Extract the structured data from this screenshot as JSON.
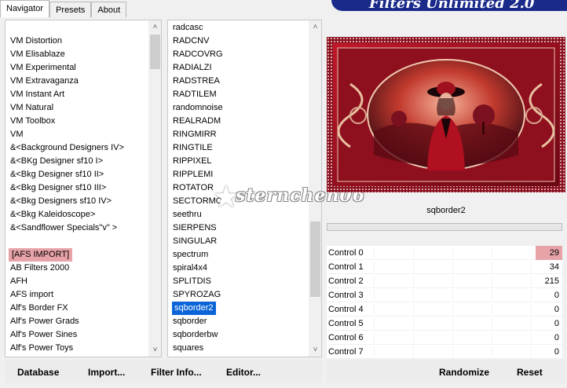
{
  "tabs": [
    {
      "label": "Navigator",
      "active": true
    },
    {
      "label": "Presets",
      "active": false
    },
    {
      "label": "About",
      "active": false
    }
  ],
  "banner": {
    "title": "Filters Unlimited 2.0"
  },
  "categories": [
    "VM Distortion",
    "VM Elisablaze",
    "VM Experimental",
    "VM Extravaganza",
    "VM Instant Art",
    "VM Natural",
    "VM Toolbox",
    "VM",
    "&<Background Designers IV>",
    "&<BKg Designer sf10 I>",
    "&<Bkg Designer sf10 II>",
    "&<Bkg Designer sf10 III>",
    "&<Bkg Designers sf10 IV>",
    "&<Bkg Kaleidoscope>",
    "&<Sandflower Specials\"v\" >",
    "",
    "[AFS IMPORT]",
    "AB Filters 2000",
    "AFH",
    "AFS import",
    "Alf's Border FX",
    "Alf's Power Grads",
    "Alf's Power Sines",
    "Alf's Power Toys"
  ],
  "categories_highlight_index": 16,
  "filters": [
    "radcasc",
    "RADCNV",
    "RADCOVRG",
    "RADIALZI",
    "RADSTREA",
    "RADTILEM",
    "randomnoise",
    "REALRADM",
    "RINGMIRR",
    "RINGTILE",
    "RIPPIXEL",
    "RIPPLEMI",
    "ROTATOR",
    "SECTORMO",
    "seethru",
    "SIERPENS",
    "SINGULAR",
    "spectrum",
    "spiral4x4",
    "SPLITDIS",
    "SPYROZAG",
    "sqborder2",
    "sqborder",
    "sqborderbw",
    "squares"
  ],
  "filters_selected_index": 21,
  "current_filter": "sqborder2",
  "controls": [
    {
      "label": "Control 0",
      "value": "29",
      "highlight": true
    },
    {
      "label": "Control 1",
      "value": "34",
      "highlight": false
    },
    {
      "label": "Control 2",
      "value": "215",
      "highlight": false
    },
    {
      "label": "Control 3",
      "value": "0",
      "highlight": false
    },
    {
      "label": "Control 4",
      "value": "0",
      "highlight": false
    },
    {
      "label": "Control 5",
      "value": "0",
      "highlight": false
    },
    {
      "label": "Control 6",
      "value": "0",
      "highlight": false
    },
    {
      "label": "Control 7",
      "value": "0",
      "highlight": false
    }
  ],
  "buttons": {
    "database": "Database",
    "import": "Import...",
    "filter_info": "Filter Info...",
    "editor": "Editor...",
    "randomize": "Randomize",
    "reset": "Reset"
  },
  "watermark": "sternchen06",
  "colors": {
    "highlight": "#e8a3a8",
    "selection": "#0a64d8",
    "banner": "#1a2a8a"
  }
}
